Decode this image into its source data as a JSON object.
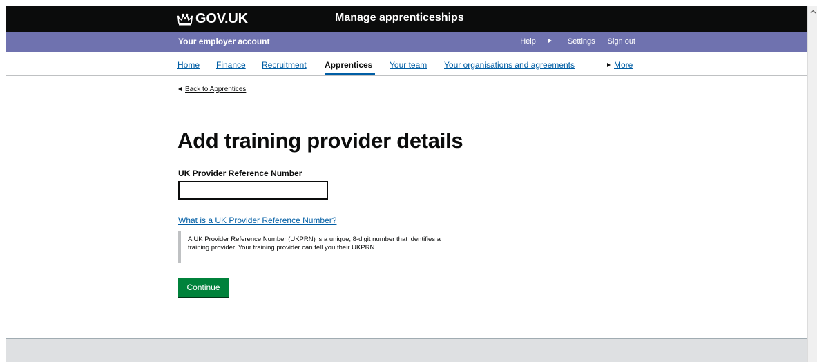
{
  "header": {
    "logo_text": "GOV.UK",
    "service_name": "Manage apprenticeships"
  },
  "account_bar": {
    "title": "Your employer account",
    "help": "Help",
    "settings": "Settings",
    "sign_out": "Sign out"
  },
  "nav": {
    "items": [
      {
        "label": "Home"
      },
      {
        "label": "Finance"
      },
      {
        "label": "Recruitment"
      },
      {
        "label": "Apprentices",
        "active": true
      },
      {
        "label": "Your team"
      },
      {
        "label": "Your organisations and agreements"
      },
      {
        "label": "More"
      }
    ]
  },
  "main": {
    "back_link": "Back to Apprentices",
    "heading": "Add training provider details",
    "field_label": "UK Provider Reference Number",
    "field_value": "",
    "details_summary": "What is a UK Provider Reference Number?",
    "details_text_line1": "A UK Provider Reference Number (UKPRN) is a unique, 8-digit number that identifies a",
    "details_text_line2": "training provider. Your training provider can tell you their UKPRN.",
    "continue_label": "Continue"
  },
  "colors": {
    "header_bg": "#0b0c0c",
    "account_bar_bg": "#6f72af",
    "link": "#005ea5",
    "button_green": "#00823b",
    "footer_bg": "#dee0e2"
  },
  "icons": {
    "logo": "crown-icon",
    "settings": "triangle-right-icon",
    "more": "triangle-right-icon",
    "back": "triangle-left-icon",
    "scroll_up": "chevron-up-icon"
  }
}
